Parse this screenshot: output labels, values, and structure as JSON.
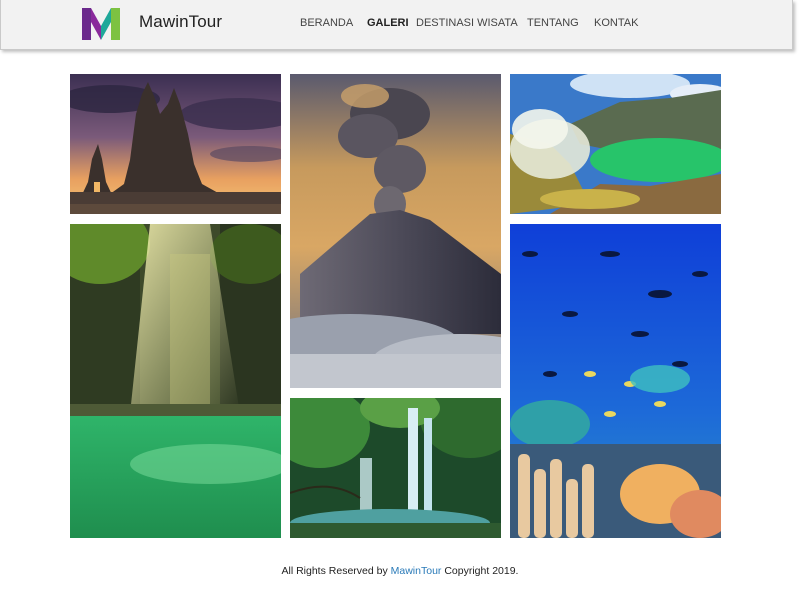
{
  "header": {
    "brand": "MawinTour",
    "logo_icon": "mawintour-logo-icon",
    "nav": [
      {
        "label": "BERANDA",
        "active": false
      },
      {
        "label": "GALERI",
        "active": true
      },
      {
        "label": "DESTINASI WISATA",
        "active": false
      },
      {
        "label": "TENTANG",
        "active": false
      },
      {
        "label": "KONTAK",
        "active": false
      }
    ]
  },
  "gallery": {
    "images": [
      {
        "subject": "temple-at-sunset"
      },
      {
        "subject": "volcano-eruption"
      },
      {
        "subject": "crater-lake"
      },
      {
        "subject": "canyon-river"
      },
      {
        "subject": "coral-reef-fish"
      },
      {
        "subject": "jungle-waterfall"
      }
    ]
  },
  "footer": {
    "prefix": "All Rights Reserved by",
    "link": "MawinTour",
    "suffix": "Copyright 2019."
  },
  "colors": {
    "link": "#2a7ab8",
    "header_bg": "#f2f2f2",
    "logo_purple": "#6b2a8c",
    "logo_teal": "#1fa89a",
    "logo_green": "#7dc242"
  }
}
